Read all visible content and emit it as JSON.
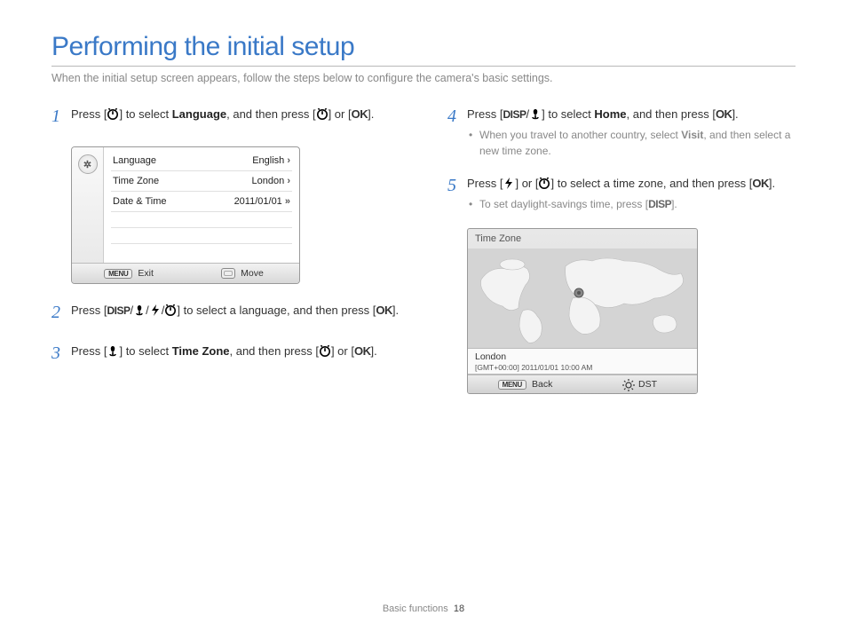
{
  "title": "Performing the initial setup",
  "subtitle": "When the initial setup screen appears, follow the steps below to configure the camera's basic settings.",
  "steps": {
    "s1": {
      "pre": "Press [",
      "mid": "] to select ",
      "target": "Language",
      "post1": ", and then press [",
      "post2": "] or [",
      "ok": "OK",
      "end": "]."
    },
    "s2": {
      "pre": "Press [",
      "mid": "] to select a language, and then press [",
      "ok": "OK",
      "end": "]."
    },
    "s3": {
      "pre": "Press [",
      "mid": "] to select ",
      "target": "Time Zone",
      "post1": ", and then press [",
      "post2": "] or [",
      "ok": "OK",
      "end": "]."
    },
    "s4": {
      "pre": "Press [",
      "mid": "] to select ",
      "target": "Home",
      "post1": ", and then press [",
      "ok": "OK",
      "end": "].",
      "bullet": "When you travel to another country, select ",
      "bullet_bold": "Visit",
      "bullet_end": ", and then select a new time zone."
    },
    "s5": {
      "pre": "Press [",
      "mid1": "] or [",
      "mid2": "] to select a time zone, and then press [",
      "ok": "OK",
      "end": "].",
      "bullet": "To set daylight-savings time, press [",
      "bullet_end": "]."
    }
  },
  "lcd1": {
    "rows": [
      {
        "label": "Language",
        "value": "English"
      },
      {
        "label": "Time Zone",
        "value": "London"
      },
      {
        "label": "Date & Time",
        "value": "2011/01/01"
      }
    ],
    "menu_btn": "MENU",
    "exit": "Exit",
    "move": "Move"
  },
  "lcd2": {
    "head": "Time Zone",
    "loc_name": "London",
    "loc_tz": "[GMT+00:00] 2011/01/01 10:00 AM",
    "menu_btn": "MENU",
    "back": "Back",
    "dst": "DST"
  },
  "labels": {
    "disp": "DISP"
  },
  "footer": {
    "section": "Basic functions",
    "page": "18"
  }
}
